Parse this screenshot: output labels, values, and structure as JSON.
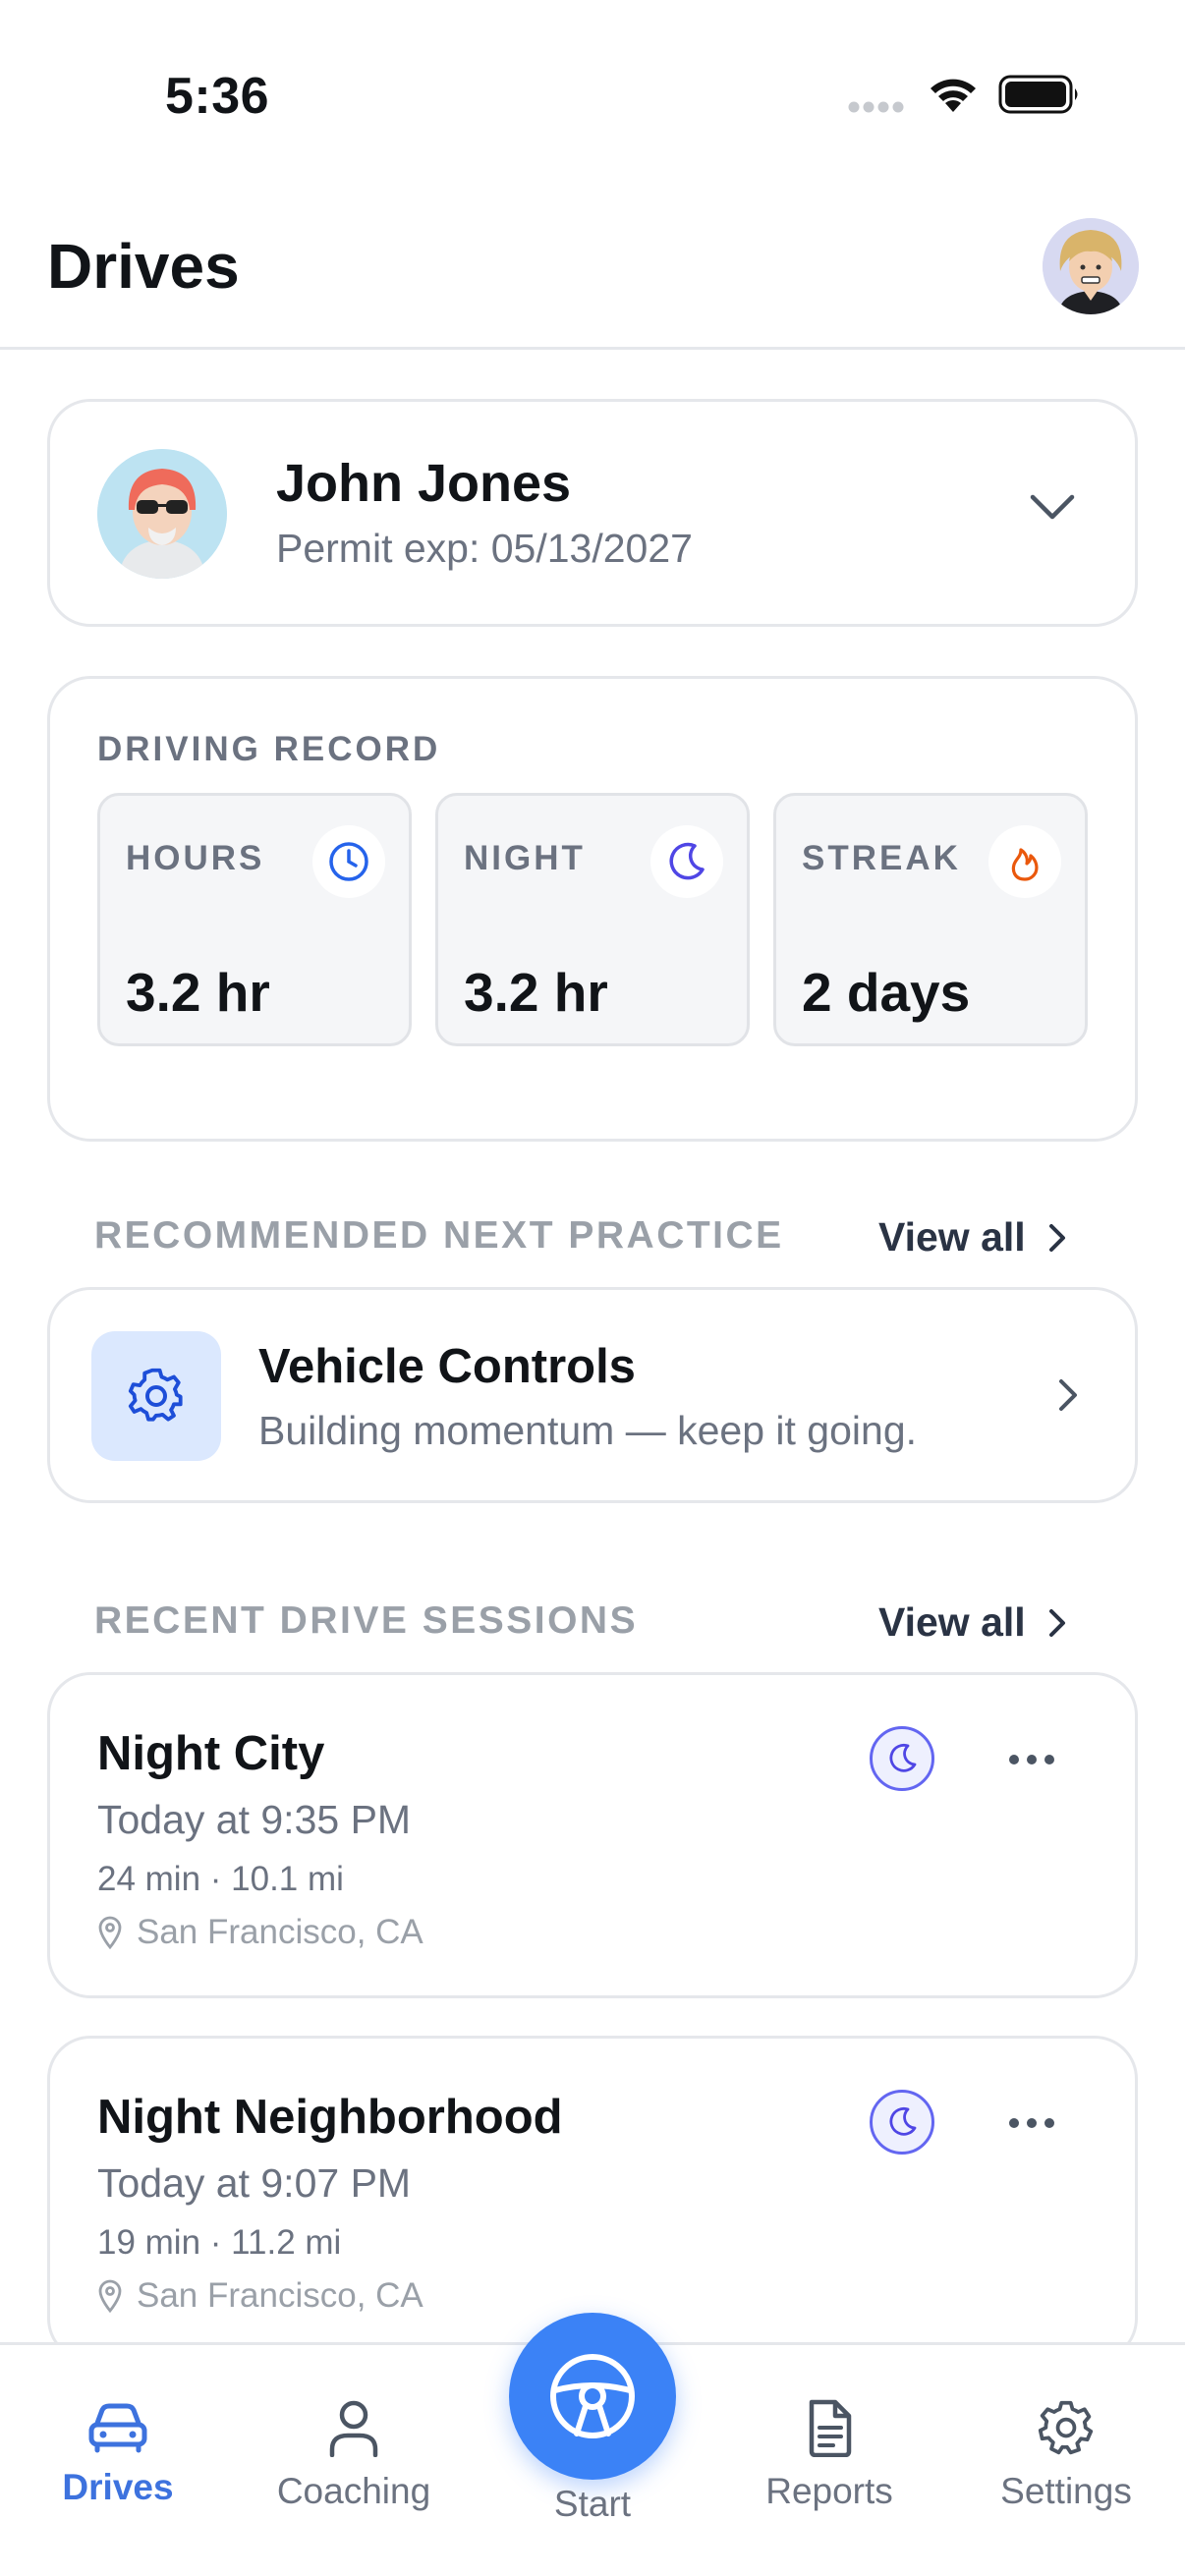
{
  "status_bar": {
    "time": "5:36"
  },
  "header": {
    "title": "Drives"
  },
  "driver": {
    "name": "John Jones",
    "permit": "Permit exp: 05/13/2027"
  },
  "record": {
    "title": "DRIVING RECORD",
    "stats": [
      {
        "label": "HOURS",
        "value": "3.2 hr",
        "icon": "clock-icon",
        "color": "#2563eb"
      },
      {
        "label": "NIGHT",
        "value": "3.2 hr",
        "icon": "moon-icon",
        "color": "#4f46e5"
      },
      {
        "label": "STREAK",
        "value": "2 days",
        "icon": "flame-icon",
        "color": "#ea580c"
      }
    ]
  },
  "recommended": {
    "heading": "RECOMMENDED NEXT PRACTICE",
    "view_all": "View all",
    "title": "Vehicle Controls",
    "subtitle": "Building momentum — keep it going."
  },
  "recent": {
    "heading": "RECENT DRIVE SESSIONS",
    "view_all": "View all",
    "sessions": [
      {
        "title": "Night City",
        "time": "Today at 9:35 PM",
        "meta": "24 min · 10.1 mi",
        "location": "San Francisco, CA"
      },
      {
        "title": "Night Neighborhood",
        "time": "Today at 9:07 PM",
        "meta": "19 min · 11.2 mi",
        "location": "San Francisco, CA"
      }
    ]
  },
  "tabs": [
    {
      "label": "Drives",
      "active": true
    },
    {
      "label": "Coaching",
      "active": false
    },
    {
      "label": "Start",
      "active": false
    },
    {
      "label": "Reports",
      "active": false
    },
    {
      "label": "Settings",
      "active": false
    }
  ],
  "colors": {
    "accent": "#3b82f6",
    "active_tab": "#3d72de",
    "night": "#4f46e5",
    "streak": "#ea580c"
  }
}
